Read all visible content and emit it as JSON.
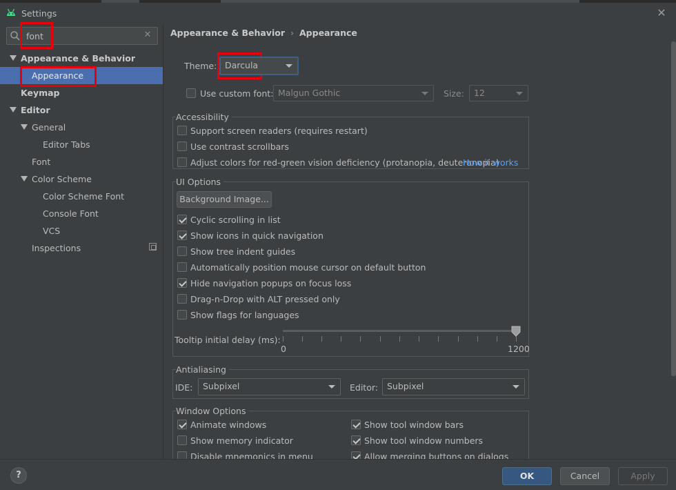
{
  "window": {
    "title": "Settings"
  },
  "search": {
    "value": "font",
    "placeholder": ""
  },
  "sidebar": {
    "items": [
      {
        "label": "Appearance & Behavior"
      },
      {
        "label": "Appearance"
      },
      {
        "label": "Keymap"
      },
      {
        "label": "Editor"
      },
      {
        "label": "General"
      },
      {
        "label": "Editor Tabs"
      },
      {
        "label": "Font"
      },
      {
        "label": "Color Scheme"
      },
      {
        "label": "Color Scheme Font"
      },
      {
        "label": "Console Font"
      },
      {
        "label": "VCS"
      },
      {
        "label": "Inspections"
      }
    ]
  },
  "breadcrumb": {
    "parent": "Appearance & Behavior",
    "separator": "›",
    "current": "Appearance"
  },
  "theme": {
    "label": "Theme:",
    "value": "Darcula"
  },
  "custom_font": {
    "label": "Use custom font:",
    "checked": false,
    "font_value": "Malgun Gothic",
    "size_label": "Size:",
    "size_value": "12"
  },
  "accessibility": {
    "title": "Accessibility",
    "options": [
      {
        "label": "Support screen readers (requires restart)",
        "checked": false
      },
      {
        "label": "Use contrast scrollbars",
        "checked": false
      },
      {
        "label": "Adjust colors for red-green vision deficiency (protanopia, deuteranopia)",
        "checked": false
      }
    ],
    "link": "How it works"
  },
  "ui_options": {
    "title": "UI Options",
    "bg_button": "Background Image...",
    "options": [
      {
        "label": "Cyclic scrolling in list",
        "checked": true
      },
      {
        "label": "Show icons in quick navigation",
        "checked": true
      },
      {
        "label": "Show tree indent guides",
        "checked": false
      },
      {
        "label": "Automatically position mouse cursor on default button",
        "checked": false
      },
      {
        "label": "Hide navigation popups on focus loss",
        "checked": true
      },
      {
        "label": "Drag-n-Drop with ALT pressed only",
        "checked": false
      },
      {
        "label": "Show flags for languages",
        "checked": false
      }
    ],
    "tooltip_label": "Tooltip initial delay (ms):",
    "tooltip_min": "0",
    "tooltip_max": "1200",
    "tooltip_value": 1200
  },
  "antialiasing": {
    "title": "Antialiasing",
    "ide_label": "IDE:",
    "ide_value": "Subpixel",
    "editor_label": "Editor:",
    "editor_value": "Subpixel"
  },
  "window_options": {
    "title": "Window Options",
    "left": [
      {
        "label": "Animate windows",
        "checked": true
      },
      {
        "label": "Show memory indicator",
        "checked": false
      },
      {
        "label": "Disable mnemonics in menu",
        "checked": false
      }
    ],
    "right": [
      {
        "label": "Show tool window bars",
        "checked": true
      },
      {
        "label": "Show tool window numbers",
        "checked": true
      },
      {
        "label": "Allow merging buttons on dialogs",
        "checked": true
      }
    ]
  },
  "footer": {
    "help": "?",
    "ok": "OK",
    "cancel": "Cancel",
    "apply": "Apply"
  },
  "colors": {
    "accent": "#4b6eaf",
    "highlight": "#e8000b",
    "link": "#589df6",
    "background": "#3c3f41"
  }
}
